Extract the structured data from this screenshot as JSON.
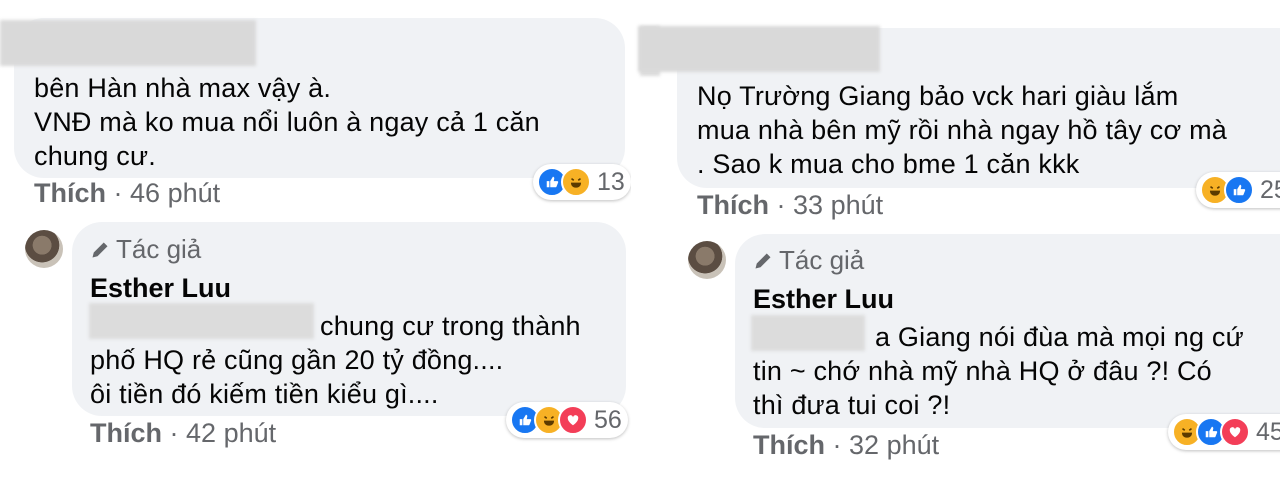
{
  "left": {
    "comment1": {
      "text": "bên Hàn nhà max vậy à.\nVNĐ mà ko mua nổi luôn à ngay cả 1 căn\nchung cư.",
      "like_label": "Thích",
      "separator": "·",
      "time": "46 phút",
      "reaction_count": "13",
      "reactions": [
        "like",
        "haha"
      ]
    },
    "reply1": {
      "tag_label": "Tác giả",
      "author": "Esther Luu",
      "text": "chung cư trong thành\nphố HQ rẻ cũng gần 20 tỷ đồng....\nôi tiền đó kiếm tiền kiểu gì....",
      "like_label": "Thích",
      "separator": "·",
      "time": "42 phút",
      "reaction_count": "56",
      "reactions": [
        "like",
        "haha",
        "love"
      ]
    }
  },
  "right": {
    "comment1": {
      "text": "Nọ Trường Giang bảo vck hari giàu lắm\nmua nhà bên mỹ rồi nhà ngay hồ tây cơ mà\n. Sao k mua cho bme 1 căn kkk",
      "like_label": "Thích",
      "separator": "·",
      "time": "33 phút",
      "reaction_count": "25",
      "reactions": [
        "haha",
        "like"
      ]
    },
    "reply1": {
      "tag_label": "Tác giả",
      "author": "Esther Luu",
      "text": "a Giang nói đùa mà mọi ng cứ\ntin ~ chớ nhà mỹ nhà HQ ở đâu ?! Có\nthì đưa tui coi ?!",
      "like_label": "Thích",
      "separator": "·",
      "time": "32 phút",
      "reaction_count": "45",
      "reactions": [
        "haha",
        "like",
        "love"
      ]
    }
  },
  "colors": {
    "bubble": "#f0f2f5",
    "meta": "#65676b",
    "like": "#1877f2",
    "haha": "#f7b125",
    "love": "#f33e58"
  }
}
